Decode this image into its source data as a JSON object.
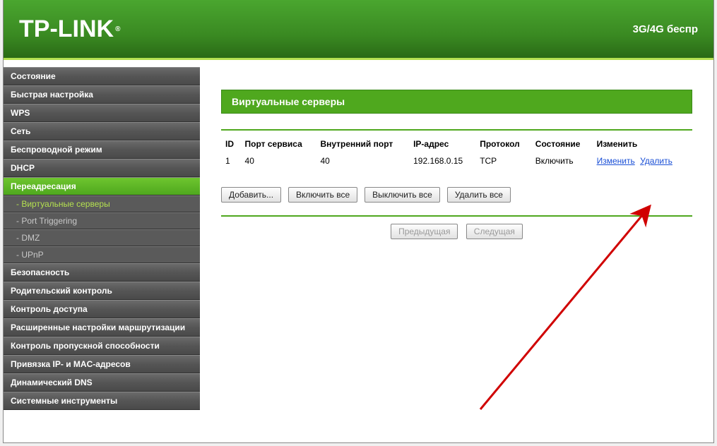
{
  "header": {
    "logo_text": "TP-LINK",
    "right_text": "3G/4G беспр"
  },
  "sidebar": {
    "items": [
      {
        "label": "Состояние",
        "type": "item"
      },
      {
        "label": "Быстрая настройка",
        "type": "item"
      },
      {
        "label": "WPS",
        "type": "item"
      },
      {
        "label": "Сеть",
        "type": "item"
      },
      {
        "label": "Беспроводной режим",
        "type": "item"
      },
      {
        "label": "DHCP",
        "type": "item"
      },
      {
        "label": "Переадресация",
        "type": "item",
        "active": true
      },
      {
        "label": "- Виртуальные серверы",
        "type": "sub",
        "active": true
      },
      {
        "label": "- Port Triggering",
        "type": "sub"
      },
      {
        "label": "- DMZ",
        "type": "sub"
      },
      {
        "label": "- UPnP",
        "type": "sub"
      },
      {
        "label": "Безопасность",
        "type": "item"
      },
      {
        "label": "Родительский контроль",
        "type": "item"
      },
      {
        "label": "Контроль доступа",
        "type": "item"
      },
      {
        "label": "Расширенные настройки маршрутизации",
        "type": "item"
      },
      {
        "label": "Контроль пропускной способности",
        "type": "item"
      },
      {
        "label": "Привязка IP- и MAC-адресов",
        "type": "item"
      },
      {
        "label": "Динамический DNS",
        "type": "item"
      },
      {
        "label": "Системные инструменты",
        "type": "item"
      }
    ]
  },
  "content": {
    "panel_title": "Виртуальные серверы",
    "table": {
      "headers": [
        "ID",
        "Порт сервиса",
        "Внутренний порт",
        "IP-адрес",
        "Протокол",
        "Состояние",
        "Изменить"
      ],
      "rows": [
        {
          "id": "1",
          "service_port": "40",
          "internal_port": "40",
          "ip": "192.168.0.15",
          "protocol": "TCP",
          "state": "Включить",
          "edit": "Изменить",
          "delete": "Удалить"
        }
      ]
    },
    "buttons": {
      "add": "Добавить...",
      "enable_all": "Включить все",
      "disable_all": "Выключить все",
      "delete_all": "Удалить все",
      "prev": "Предыдущая",
      "next": "Следущая"
    }
  }
}
